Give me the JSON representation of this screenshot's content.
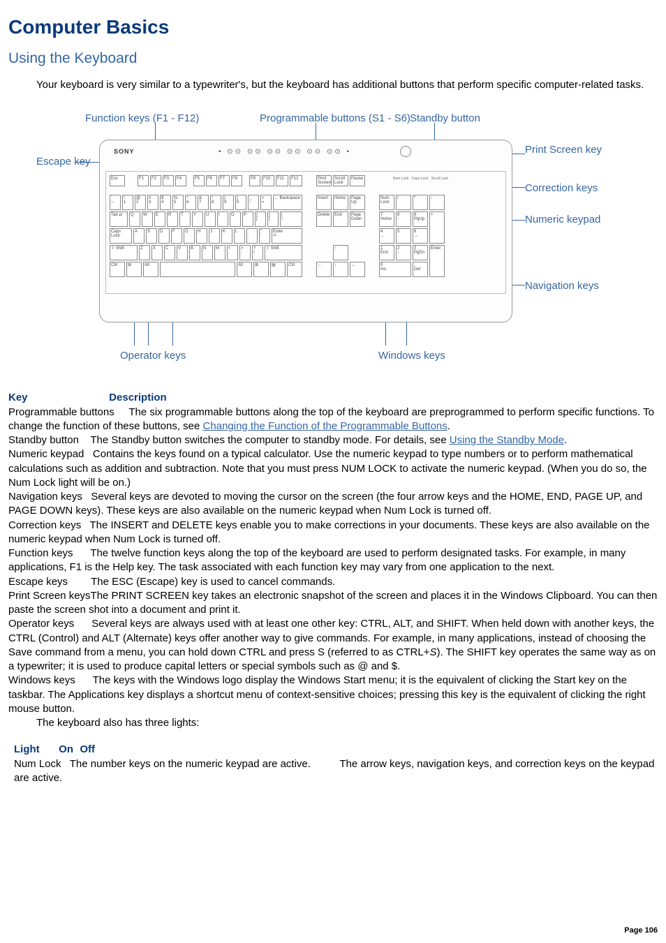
{
  "title": "Computer Basics",
  "subtitle": "Using the Keyboard",
  "intro": "Your keyboard is very similar to a typewriter's, but the keyboard has additional buttons that perform specific computer-related tasks.",
  "figure": {
    "labels": {
      "function_keys": "Function keys (F1 - F12)",
      "prog_buttons": "Programmable buttons (S1 - S6)",
      "standby": "Standby button",
      "escape": "Escape key",
      "print_screen": "Print Screen key",
      "correction": "Correction keys",
      "numeric": "Numeric keypad",
      "navigation": "Navigation keys",
      "operator": "Operator keys",
      "windows": "Windows keys"
    },
    "brand": "SONY"
  },
  "key_header": {
    "c1": "Key",
    "c2": "Description"
  },
  "keys": {
    "programmable": {
      "name": "Programmable buttons",
      "desc_a": "The six programmable buttons along the top of the keyboard are preprogrammed to perform specific functions. To change the function of these buttons, see ",
      "link": "Changing the Function of the Programmable Buttons",
      "desc_b": "."
    },
    "standby": {
      "name": "Standby button",
      "desc_a": "The Standby button switches the computer to standby mode. For details, see ",
      "link": "Using the Standby Mode",
      "desc_b": "."
    },
    "numeric": {
      "name": "Numeric keypad",
      "desc": "Contains the keys found on a typical calculator. Use the numeric keypad to type numbers or to perform mathematical calculations such as addition and subtraction. Note that you must press NUM LOCK to activate the numeric keypad. (When you do so, the Num Lock light will be on.)"
    },
    "navigation": {
      "name": "Navigation keys",
      "desc": "Several keys are devoted to moving the cursor on the screen (the four arrow keys and the HOME, END, PAGE UP, and PAGE DOWN keys). These keys are also available on the numeric keypad when Num Lock is turned off."
    },
    "correction": {
      "name": "Correction keys",
      "desc": "The INSERT and DELETE keys enable you to make corrections in your documents. These keys are also available on the numeric keypad when Num Lock is turned off."
    },
    "function": {
      "name": "Function keys",
      "desc": "The twelve function keys along the top of the keyboard are used to perform designated tasks. For example, in many applications, F1 is the Help key. The task associated with each function key may vary from one application to the next."
    },
    "escape": {
      "name": "Escape keys",
      "desc": "The ESC (Escape) key is used to cancel commands."
    },
    "printscreen": {
      "name": "Print Screen keys",
      "desc": "The PRINT SCREEN key takes an electronic snapshot of the screen and places it in the Windows Clipboard. You can then paste the screen shot into a document and print it."
    },
    "operator": {
      "name": "Operator keys",
      "desc_a": "Several keys are always used with at least one other key: CTRL, ALT, and SHIFT. When held down with another keys, the CTRL (Control) and ALT (Alternate) keys offer another way to give commands. For example, in many applications, instead of choosing the Save command from a menu, you can hold down CTRL and press S (referred to as CTRL+",
      "italic": "S",
      "desc_b": "). The SHIFT key operates the same way as on a typewriter; it is used to produce capital letters or special symbols such as @ and $."
    },
    "windows": {
      "name": "Windows keys",
      "desc": "The keys with the Windows logo display the Windows Start menu; it is the equivalent of clicking the Start key on the taskbar. The Applications key displays a shortcut menu of context-sensitive choices; pressing this key is the equivalent of clicking the right mouse button."
    }
  },
  "lights_intro": "The keyboard also has three lights:",
  "light_header": {
    "c1": "Light",
    "c2": "On",
    "c3": "Off"
  },
  "lights": {
    "numlock": {
      "name": "Num Lock",
      "on": "The number keys on the numeric keypad are active.",
      "off": "The arrow keys, navigation keys, and correction keys on the keypad are active."
    }
  },
  "page": "Page 106"
}
